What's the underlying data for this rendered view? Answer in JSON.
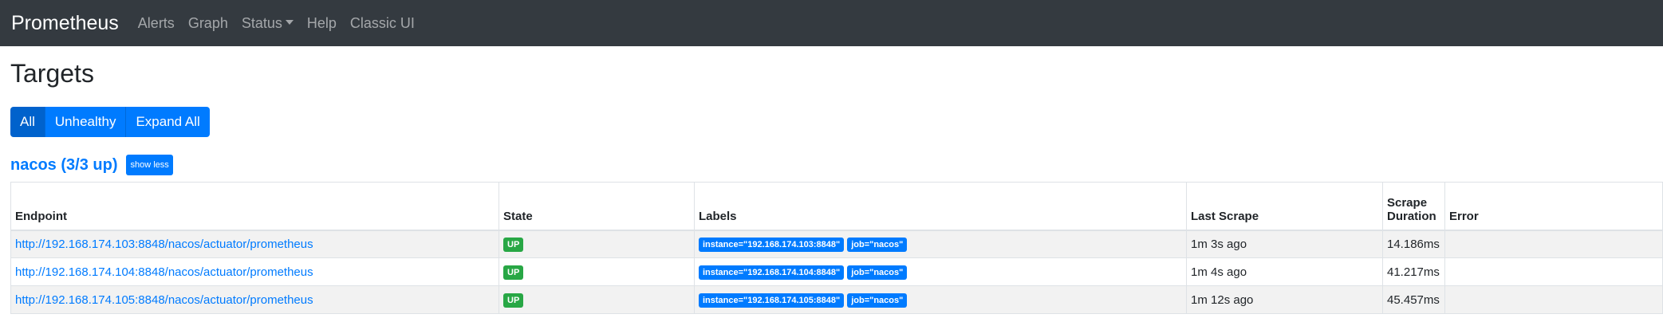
{
  "nav": {
    "brand": "Prometheus",
    "items": [
      "Alerts",
      "Graph",
      "Status",
      "Help",
      "Classic UI"
    ]
  },
  "page": {
    "title": "Targets"
  },
  "filters": {
    "all": "All",
    "unhealthy": "Unhealthy",
    "expand_all": "Expand All"
  },
  "job": {
    "title": "nacos (3/3 up)",
    "show_less": "show less"
  },
  "table": {
    "headers": {
      "endpoint": "Endpoint",
      "state": "State",
      "labels": "Labels",
      "last_scrape": "Last Scrape",
      "duration_line1": "Scrape",
      "duration_line2": "Duration",
      "error": "Error"
    },
    "rows": [
      {
        "endpoint": "http://192.168.174.103:8848/nacos/actuator/prometheus",
        "state": "UP",
        "instance_label": "instance=\"192.168.174.103:8848\"",
        "job_label": "job=\"nacos\"",
        "last_scrape": "1m 3s ago",
        "duration": "14.186ms",
        "error": ""
      },
      {
        "endpoint": "http://192.168.174.104:8848/nacos/actuator/prometheus",
        "state": "UP",
        "instance_label": "instance=\"192.168.174.104:8848\"",
        "job_label": "job=\"nacos\"",
        "last_scrape": "1m 4s ago",
        "duration": "41.217ms",
        "error": ""
      },
      {
        "endpoint": "http://192.168.174.105:8848/nacos/actuator/prometheus",
        "state": "UP",
        "instance_label": "instance=\"192.168.174.105:8848\"",
        "job_label": "job=\"nacos\"",
        "last_scrape": "1m 12s ago",
        "duration": "45.457ms",
        "error": ""
      }
    ]
  },
  "colors": {
    "navbar": "#343a40",
    "primary": "#007bff",
    "success": "#28a745"
  }
}
